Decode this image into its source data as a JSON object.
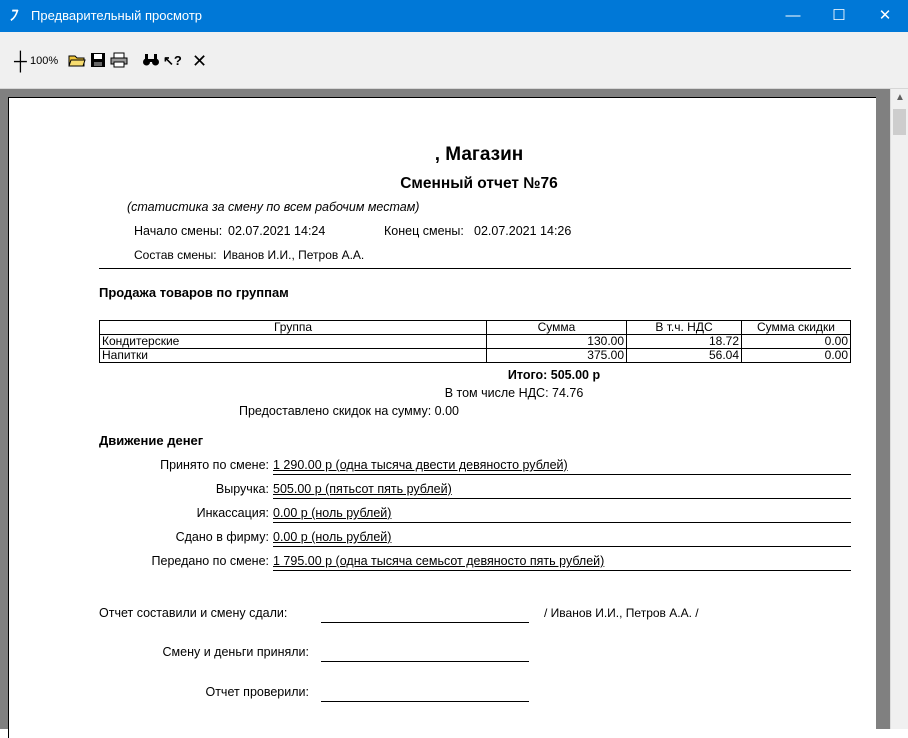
{
  "window": {
    "title": "Предварительный просмотр",
    "app_icon": "app-logo-icon",
    "minimize": "—",
    "maximize": "☐",
    "close": "✕"
  },
  "toolbar": {
    "zoom": "100%",
    "icons": [
      "zoom-pin-icon",
      "open-folder-icon",
      "save-icon",
      "print-icon",
      "find-icon",
      "help-pointer-icon",
      "close-preview-icon"
    ]
  },
  "report": {
    "store": ", Магазин",
    "title": "Сменный отчет №76",
    "subtitle": "(статистика за смену по всем рабочим местам)",
    "shift_start_label": "Начало смены:",
    "shift_start": "02.07.2021 14:24",
    "shift_end_label": "Конец смены:",
    "shift_end": "02.07.2021 14:26",
    "staff_label": "Состав смены:",
    "staff": "Иванов И.И., Петров А.А.",
    "sales_section": "Продажа товаров по группам",
    "columns": [
      "Группа",
      "Сумма",
      "В т.ч. НДС",
      "Сумма скидки"
    ],
    "rows": [
      {
        "group": "Кондитерские",
        "sum": "130.00",
        "vat": "18.72",
        "discount": "0.00"
      },
      {
        "group": "Напитки",
        "sum": "375.00",
        "vat": "56.04",
        "discount": "0.00"
      }
    ],
    "total": "Итого: 505.00 р",
    "vat_total": "В том числе НДС: 74.76",
    "discount_total": "Предоставлено скидок на сумму: 0.00",
    "money_section": "Движение денег",
    "money": [
      {
        "label": "Принято по смене:",
        "value": "1 290.00 р (одна тысяча двести девяносто рублей)"
      },
      {
        "label": "Выручка:",
        "value": "505.00 р (пятьсот пять рублей)"
      },
      {
        "label": "Инкассация:",
        "value": "0.00 р (ноль рублей)"
      },
      {
        "label": "Сдано в фирму:",
        "value": "0.00 р (ноль рублей)"
      },
      {
        "label": "Передано по смене:",
        "value": "1 795.00 р (одна тысяча семьсот девяносто пять рублей)"
      }
    ],
    "sign_made": "Отчет составили и смену сдали:",
    "sign_made_names": "/ Иванов И.И., Петров А.А. /",
    "sign_accepted": "Смену и деньги приняли:",
    "sign_checked": "Отчет проверили:"
  }
}
